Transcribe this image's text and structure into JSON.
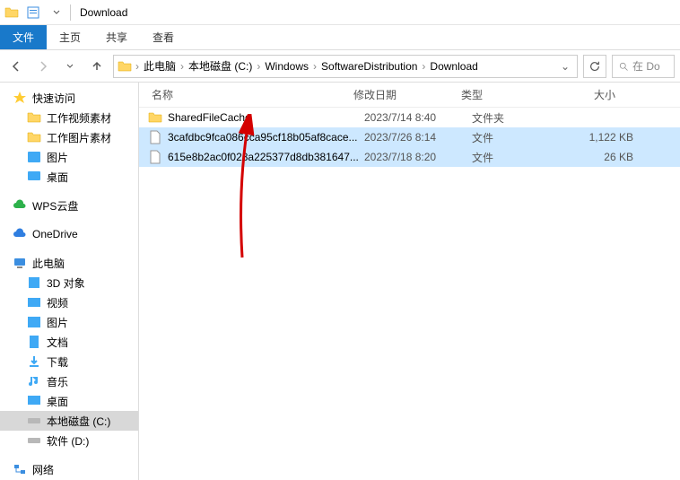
{
  "window": {
    "title": "Download"
  },
  "ribbon": {
    "file": "文件",
    "tabs": [
      "主页",
      "共享",
      "查看"
    ]
  },
  "breadcrumb": {
    "segments": [
      "此电脑",
      "本地磁盘 (C:)",
      "Windows",
      "SoftwareDistribution",
      "Download"
    ]
  },
  "search": {
    "placeholder": "在 Do"
  },
  "columns": {
    "name": "名称",
    "date": "修改日期",
    "type": "类型",
    "size": "大小"
  },
  "files": [
    {
      "name": "SharedFileCache",
      "date": "2023/7/14 8:40",
      "type": "文件夹",
      "size": "",
      "isFolder": true,
      "selected": false
    },
    {
      "name": "3cafdbc9fca086cca95cf18b05af8cace...",
      "date": "2023/7/26 8:14",
      "type": "文件",
      "size": "1,122 KB",
      "isFolder": false,
      "selected": true
    },
    {
      "name": "615e8b2ac0f028a225377d8db381647...",
      "date": "2023/7/18 8:20",
      "type": "文件",
      "size": "26 KB",
      "isFolder": false,
      "selected": true
    }
  ],
  "sidebar": {
    "quickAccess": {
      "label": "快速访问",
      "items": [
        "工作视频素材",
        "工作图片素材",
        "图片",
        "桌面"
      ]
    },
    "wps": "WPS云盘",
    "onedrive": "OneDrive",
    "thispc": {
      "label": "此电脑",
      "items": [
        "3D 对象",
        "视频",
        "图片",
        "文档",
        "下载",
        "音乐",
        "桌面",
        "本地磁盘 (C:)",
        "软件 (D:)"
      ]
    },
    "network": "网络"
  }
}
